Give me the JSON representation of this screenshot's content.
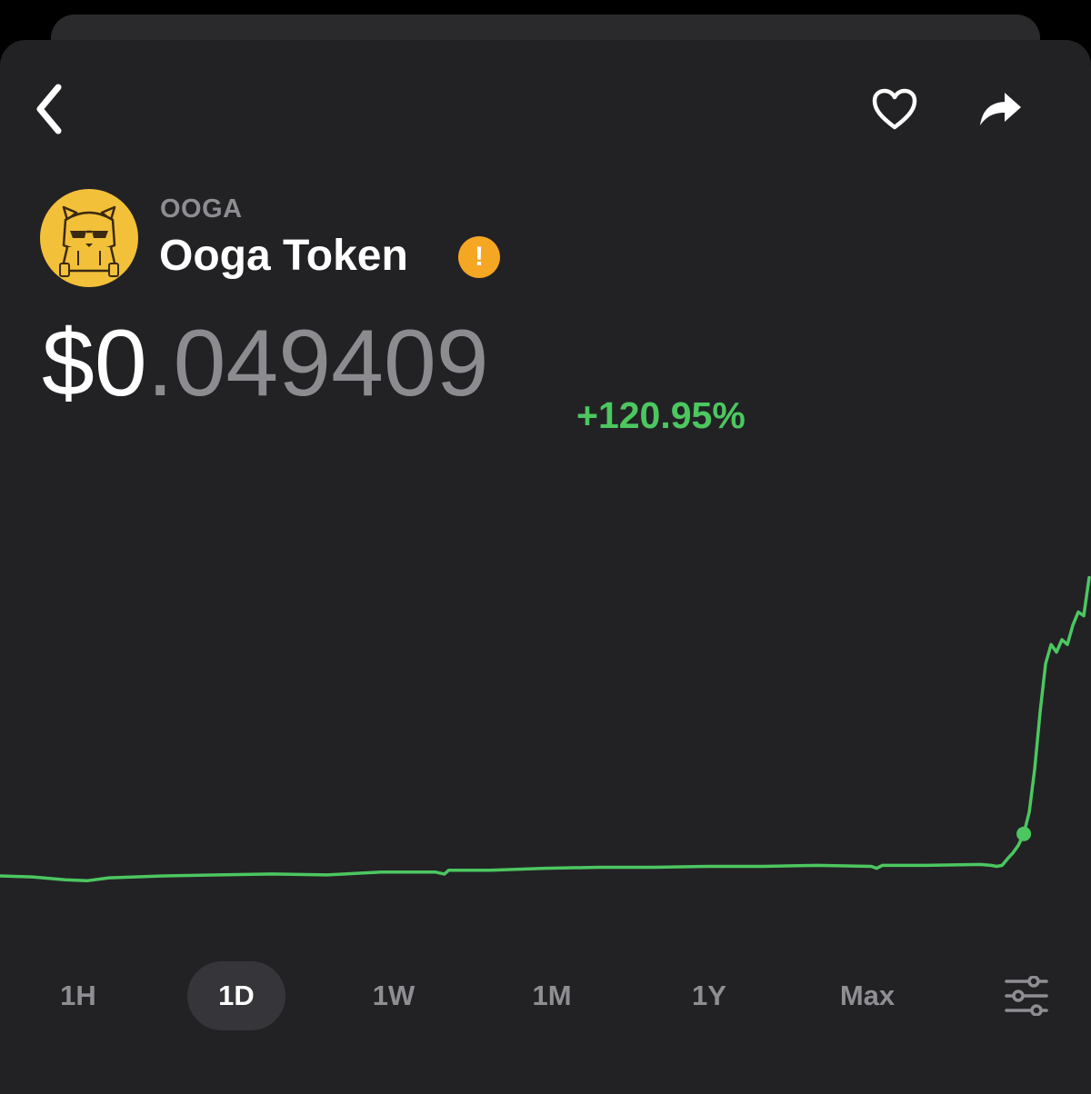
{
  "header": {
    "back_icon": "chevron-left-icon",
    "favorite_icon": "heart-outline-icon",
    "share_icon": "share-arrow-icon"
  },
  "token": {
    "ticker": "OOGA",
    "name": "Ooga Token",
    "logo_icon": "bear-with-sunglasses-logo",
    "warning_icon": "exclamation-icon",
    "warning_symbol": "!",
    "price_whole": "$0",
    "price_fraction": ".049409",
    "change": "+120.95%"
  },
  "colors": {
    "background": "#222225",
    "accent_green": "#4cc760",
    "muted_text": "#8e8e93",
    "warning": "#f5a623",
    "logo_yellow": "#f3c03a"
  },
  "chart_data": {
    "type": "line",
    "x": [
      0,
      0.03,
      0.06,
      0.08,
      0.1,
      0.15,
      0.2,
      0.25,
      0.3,
      0.35,
      0.4,
      0.408,
      0.412,
      0.45,
      0.5,
      0.55,
      0.6,
      0.65,
      0.7,
      0.75,
      0.8,
      0.805,
      0.81,
      0.85,
      0.9,
      0.91,
      0.915,
      0.92,
      0.925,
      0.93,
      0.935,
      0.94,
      0.945,
      0.95,
      0.955,
      0.96,
      0.965,
      0.97,
      0.975,
      0.98,
      0.985,
      0.99,
      0.995,
      1.0
    ],
    "values": [
      0.0218,
      0.0217,
      0.0214,
      0.0213,
      0.0216,
      0.0218,
      0.0219,
      0.022,
      0.0219,
      0.0222,
      0.0222,
      0.022,
      0.0224,
      0.0224,
      0.0226,
      0.0227,
      0.0227,
      0.0228,
      0.0228,
      0.0229,
      0.0228,
      0.0226,
      0.0229,
      0.0229,
      0.023,
      0.0229,
      0.0228,
      0.0229,
      0.0236,
      0.0242,
      0.025,
      0.0262,
      0.0285,
      0.033,
      0.039,
      0.044,
      0.046,
      0.0452,
      0.0465,
      0.046,
      0.048,
      0.0494,
      0.049,
      0.053
    ],
    "marker_x": 0.94,
    "ylim": [
      0.018,
      0.056
    ],
    "grid": false,
    "line_color": "#4cc760"
  },
  "ranges": {
    "items": [
      {
        "label": "1H",
        "active": false
      },
      {
        "label": "1D",
        "active": true
      },
      {
        "label": "1W",
        "active": false
      },
      {
        "label": "1M",
        "active": false
      },
      {
        "label": "1Y",
        "active": false
      },
      {
        "label": "Max",
        "active": false
      }
    ],
    "settings_icon": "sliders-icon"
  }
}
